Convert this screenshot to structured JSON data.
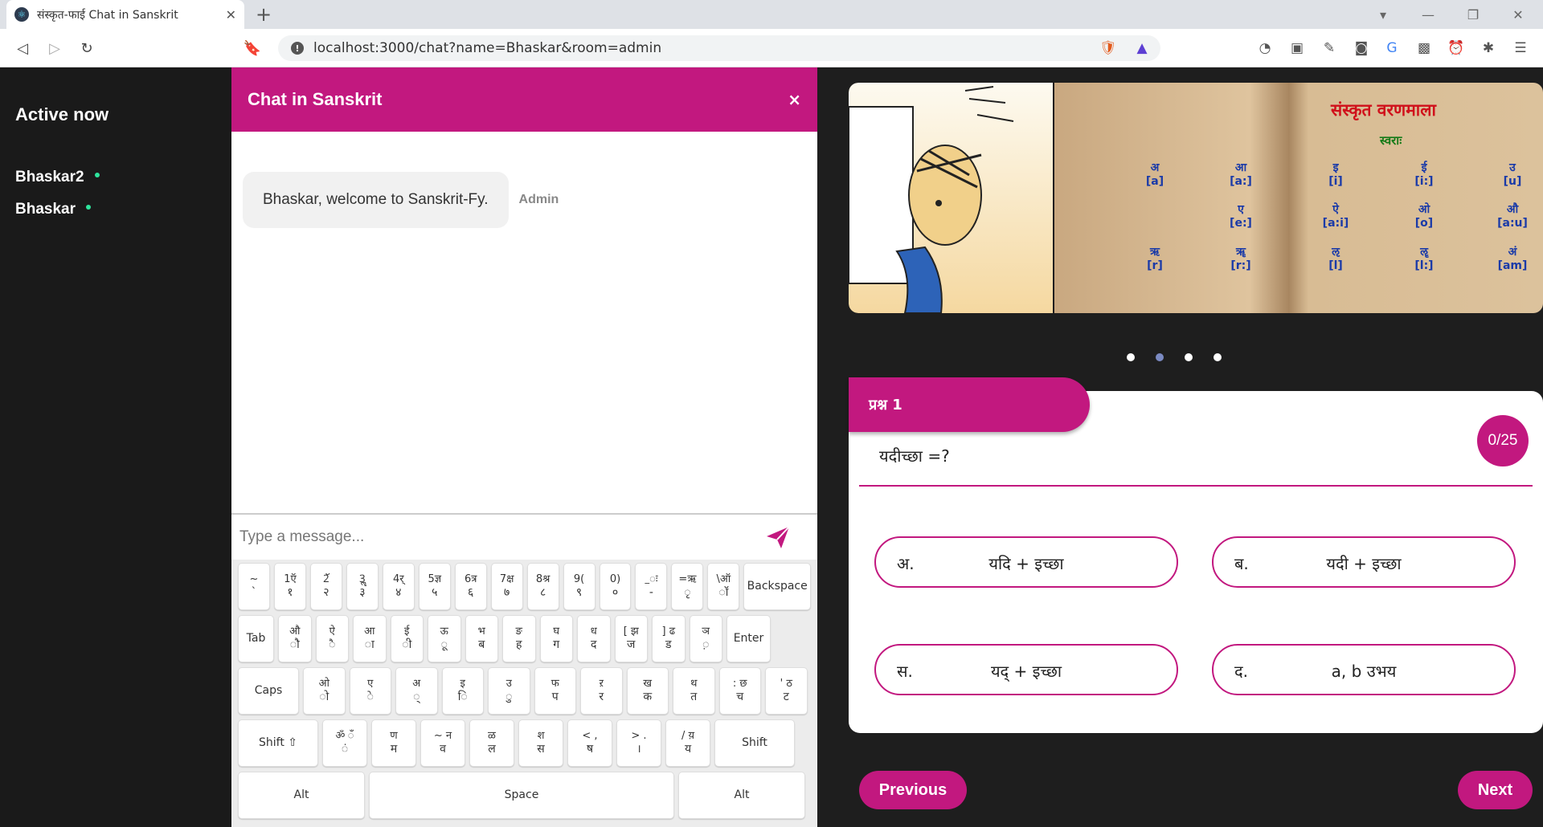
{
  "browser": {
    "tab_title": "संस्कृत-फाई Chat in Sanskrit",
    "url": "localhost:3000/chat?name=Bhaskar&room=admin"
  },
  "sidebar": {
    "title": "Active now",
    "users": [
      "Bhaskar2",
      "Bhaskar"
    ]
  },
  "chat": {
    "title": "Chat in Sanskrit",
    "close": "×",
    "messages": [
      {
        "text": "Bhaskar, welcome to Sanskrit-Fy.",
        "sender": "Admin"
      }
    ],
    "input_placeholder": "Type a message..."
  },
  "keyboard": {
    "row1": [
      [
        "~",
        "`"
      ],
      [
        "1ऍ",
        "१"
      ],
      [
        "2ॅ",
        "२"
      ],
      [
        "3ॣ",
        "३"
      ],
      [
        "4र्",
        "४"
      ],
      [
        "5ज्ञ",
        "५"
      ],
      [
        "6त्र",
        "६"
      ],
      [
        "7क्ष",
        "७"
      ],
      [
        "8श्र",
        "८"
      ],
      [
        "9(",
        "९"
      ],
      [
        "0)",
        "०"
      ],
      [
        "_ः",
        "-"
      ],
      [
        "=ऋ",
        "ृ"
      ],
      [
        "\\ऑ",
        "ॉ"
      ]
    ],
    "row2": [
      [
        "औ",
        "ौ"
      ],
      [
        "ऐ",
        "ै"
      ],
      [
        "आ",
        "ा"
      ],
      [
        "ई",
        "ी"
      ],
      [
        "ऊ",
        "ू"
      ],
      [
        "भ",
        "ब"
      ],
      [
        "ङ",
        "ह"
      ],
      [
        "घ",
        "ग"
      ],
      [
        "ध",
        "द"
      ],
      [
        "[ झ",
        "ज"
      ],
      [
        "] ढ",
        "ड"
      ],
      [
        "ञ",
        "़"
      ]
    ],
    "row3": [
      [
        "ओ",
        "ो"
      ],
      [
        "ए",
        "े"
      ],
      [
        "अ",
        "्"
      ],
      [
        "इ",
        "ि"
      ],
      [
        "उ",
        "ु"
      ],
      [
        "फ",
        "प"
      ],
      [
        "ऱ",
        "र"
      ],
      [
        "ख",
        "क"
      ],
      [
        "थ",
        "त"
      ],
      [
        ": छ",
        "च"
      ],
      [
        "' ठ",
        "ट"
      ]
    ],
    "row4": [
      [
        "ॐ ँ",
        "ं"
      ],
      [
        "ण",
        "म"
      ],
      [
        "~ न",
        "व"
      ],
      [
        "ळ",
        "ल"
      ],
      [
        "श",
        "स"
      ],
      [
        "< ,",
        "ष"
      ],
      [
        "> .",
        "।"
      ],
      [
        "/ य़",
        "य"
      ]
    ],
    "backspace": "Backspace",
    "tab": "Tab",
    "enter": "Enter",
    "caps": "Caps",
    "shift_left": "Shift ⇧",
    "shift_right": "Shift",
    "alt": "Alt",
    "space": "Space"
  },
  "carousel": {
    "title": "संस्कृत वरणमाला",
    "subtitle": "स्वराः",
    "cells": [
      [
        "अ",
        "[a]"
      ],
      [
        "आ",
        "[a:]"
      ],
      [
        "इ",
        "[i]"
      ],
      [
        "ई",
        "[i:]"
      ],
      [
        "उ",
        "[u]"
      ],
      [
        "",
        ""
      ],
      [
        "ए",
        "[e:]"
      ],
      [
        "ऐ",
        "[a:i]"
      ],
      [
        "ओ",
        "[o]"
      ],
      [
        "औ",
        "[a:u]"
      ],
      [
        "ऋ",
        "[r]"
      ],
      [
        "ॠ",
        "[r:]"
      ],
      [
        "ऌ",
        "[l]"
      ],
      [
        "ॡ",
        "[l:]"
      ],
      [
        "अं",
        "[am]"
      ]
    ],
    "active_slide": 2,
    "slides": 4
  },
  "quiz": {
    "tag": "प्रश्न 1",
    "score": "0/25",
    "question": "यदीच्छा =?",
    "options": [
      {
        "label": "अ.",
        "text": "यदि + इच्छा"
      },
      {
        "label": "ब.",
        "text": "यदी + इच्छा"
      },
      {
        "label": "स.",
        "text": "यद् + इच्छा"
      },
      {
        "label": "द.",
        "text": "a, b उभय"
      }
    ],
    "prev": "Previous",
    "next": "Next"
  },
  "colors": {
    "accent": "#c2187f",
    "online": "#2ee59d"
  }
}
